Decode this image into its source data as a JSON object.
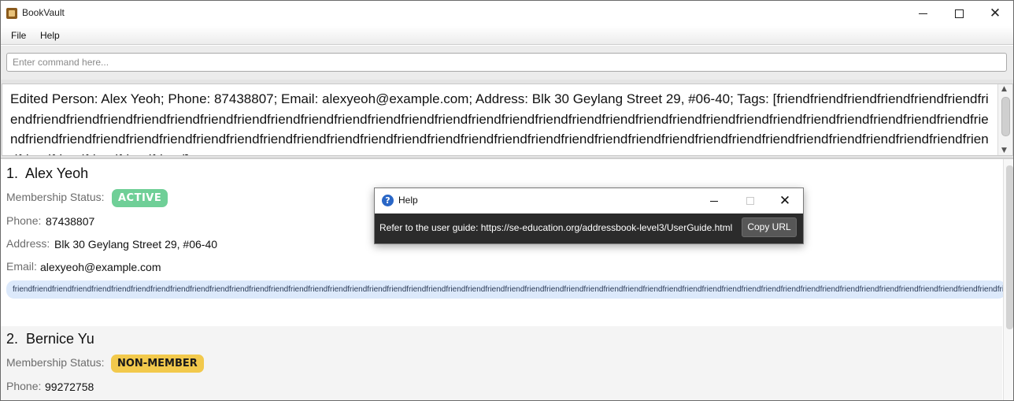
{
  "window": {
    "title": "BookVault",
    "icon": "bookvault-app-icon"
  },
  "menu": {
    "file": "File",
    "help": "Help"
  },
  "command": {
    "placeholder": "Enter command here...",
    "value": ""
  },
  "result": {
    "text": "Edited Person: Alex Yeoh; Phone: 87438807; Email: alexyeoh@example.com; Address: Blk 30 Geylang Street 29, #06-40; Tags: [friendfriendfriendfriendfriendfriendfriendfriendfriendfriendfriendfriendfriendfriendfriendfriendfriendfriendfriendfriendfriendfriendfriendfriendfriendfriendfriendfriendfriendfriendfriendfriendfriendfriendfriendfriendfriendfriendfriendfriendfriendfriendfriendfriendfriendfriendfriendfriendfriendfriendfriendfriendfriendfriendfriendfriendfriendfriendfriendfriendfriendfriendfriendfriendfriendfriendfriendfriendfriendfriend]"
  },
  "persons": [
    {
      "index": "1.",
      "name": "Alex Yeoh",
      "membership_label": "Membership Status:",
      "membership": "ACTIVE",
      "phone_label": "Phone:",
      "phone": "87438807",
      "address_label": "Address:",
      "address": "Blk 30 Geylang Street 29, #06-40",
      "email_label": "Email:",
      "email": "alexyeoh@example.com",
      "tags": "friendfriendfriendfriendfriendfriendfriendfriendfriendfriendfriendfriendfriendfriendfriendfriendfriendfriendfriendfriendfriendfriendfriendfriendfriendfriendfriendfriendfriendfriendfriendfriendfriendfriendfriendfriendfriendfriendfriendfriendfriendfriendfriendfriendfriendfriendfriendfriendfriendfriendfriendfriendfriendfriendfriendfriendfriendfriendfriendfriendfriendfriendfriendfriendfriendfriendfriendfriendfriendfriend"
    },
    {
      "index": "2.",
      "name": "Bernice Yu",
      "membership_label": "Membership Status:",
      "membership": "NON-MEMBER",
      "phone_label": "Phone:",
      "phone": "99272758"
    }
  ],
  "help_dialog": {
    "title": "Help",
    "message": "Refer to the user guide: https://se-education.org/addressbook-level3/UserGuide.html",
    "copy_button": "Copy URL"
  },
  "colors": {
    "active_badge": "#6fcf97",
    "non_member_badge": "#f2c94c",
    "tag_background": "#dce9fb",
    "dialog_background": "#2b2b2b"
  }
}
